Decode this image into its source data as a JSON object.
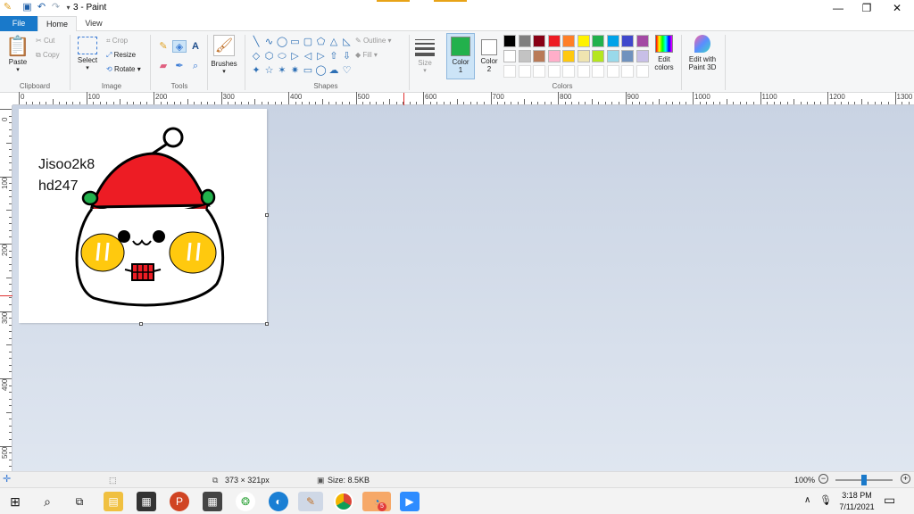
{
  "window": {
    "title": "3 - Paint",
    "app_icon": "paint-icon",
    "quick_access": [
      "save-icon",
      "undo-icon",
      "redo-icon",
      "customize-icon"
    ],
    "controls": [
      "minimize-icon",
      "restore-icon",
      "close-icon"
    ]
  },
  "tabs": {
    "file": "File",
    "home": "Home",
    "view": "View"
  },
  "ribbon": {
    "clipboard": {
      "paste": "Paste",
      "cut": "Cut",
      "copy": "Copy",
      "group": "Clipboard"
    },
    "image": {
      "select": "Select",
      "crop": "Crop",
      "resize": "Resize",
      "rotate": "Rotate",
      "group": "Image"
    },
    "tools": {
      "group": "Tools",
      "items": [
        "pencil-icon",
        "fill-icon",
        "text-icon",
        "eraser-icon",
        "color-picker-icon",
        "magnifier-icon"
      ]
    },
    "brushes": {
      "label": "Brushes"
    },
    "shapes": {
      "outline": "Outline",
      "fill": "Fill",
      "group": "Shapes",
      "items": [
        "╲",
        "∿",
        "◯",
        "▭",
        "▢",
        "⬠",
        "△",
        "◺",
        "◇",
        "⬡",
        "⬭",
        "▷",
        "◁",
        "▷",
        "⇧",
        "⇩",
        "✦",
        "☆",
        "✶",
        "✷",
        "▭",
        "◯",
        "☁",
        "♡"
      ]
    },
    "size": {
      "label": "Size"
    },
    "color1": {
      "label": "Color",
      "label2": "1",
      "value": "#22b14c"
    },
    "color2": {
      "label": "Color",
      "label2": "2",
      "value": "#ffffff"
    },
    "colors": {
      "group": "Colors",
      "row1": [
        "#000000",
        "#7f7f7f",
        "#880015",
        "#ed1c24",
        "#ff7f27",
        "#fff200",
        "#22b14c",
        "#00a2e8",
        "#3f48cc",
        "#a349a4"
      ],
      "row2": [
        "#ffffff",
        "#c3c3c3",
        "#b97a57",
        "#ffaec9",
        "#ffc90e",
        "#efe4b0",
        "#b5e61d",
        "#99d9ea",
        "#7092be",
        "#c8bfe7"
      ]
    },
    "edit_colors": {
      "line1": "Edit",
      "line2": "colors"
    },
    "paint3d": {
      "line1": "Edit with",
      "line2": "Paint 3D"
    }
  },
  "rulers": {
    "h_labels": [
      "0",
      "100",
      "200",
      "300",
      "400",
      "500",
      "600",
      "700",
      "800",
      "900",
      "1000",
      "1100",
      "1200",
      "1300"
    ],
    "v_labels": [
      "0",
      "100",
      "200",
      "300",
      "400",
      "500"
    ]
  },
  "canvas": {
    "text_line1": "Jisoo2k8",
    "text_line2": "hd247"
  },
  "status": {
    "dimensions": "373 × 321px",
    "size": "Size: 8.5KB",
    "zoom": "100%",
    "zoom_level": 100
  },
  "taskbar": {
    "time": "3:18 PM",
    "date": "7/11/2021",
    "badge": "5"
  }
}
